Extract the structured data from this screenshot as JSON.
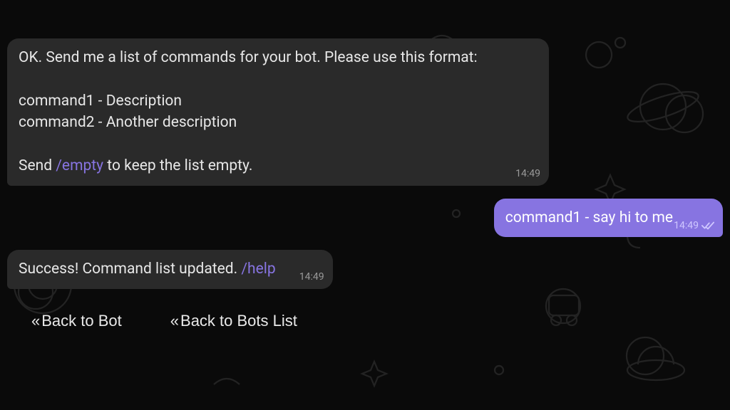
{
  "messages": {
    "m1": {
      "pre": "OK. Send me a list of commands for your bot. Please use this format:\n\ncommand1 - Description\ncommand2 - Another description\n\nSend ",
      "cmd": "/empty",
      "post": " to keep the list empty.",
      "time": "14:49"
    },
    "m2": {
      "text": "command1 - say hi to me",
      "time": "14:49",
      "status": "read"
    },
    "m3": {
      "pre": "Success! Command list updated. ",
      "cmd": "/help",
      "time": "14:49"
    }
  },
  "keyboard": {
    "b1": "Back to Bot",
    "b2": "Back to Bots List"
  },
  "glyphs": {
    "chevrons": "«"
  }
}
